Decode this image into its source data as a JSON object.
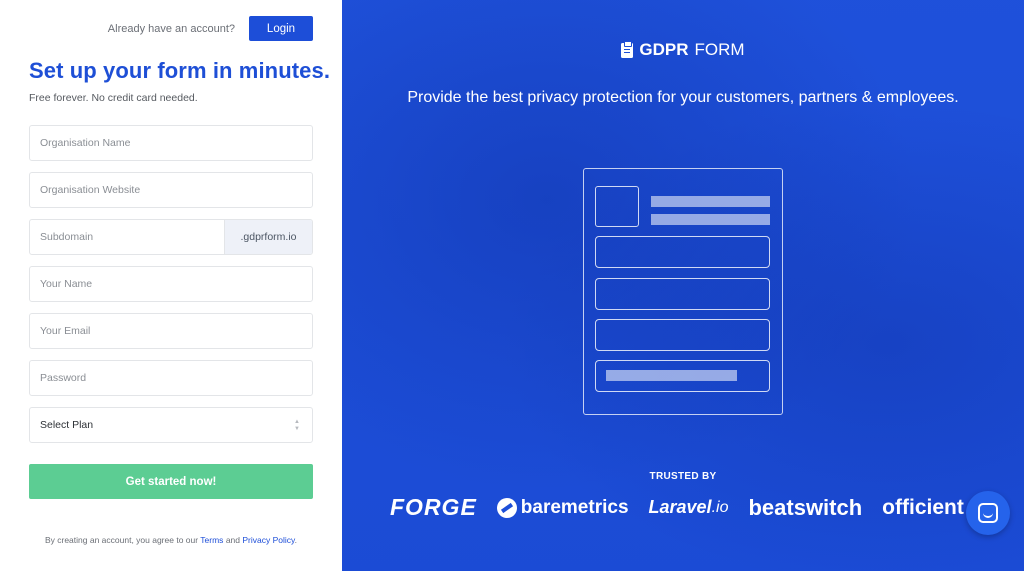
{
  "header": {
    "already_text": "Already have an account?",
    "login_label": "Login"
  },
  "signup": {
    "headline": "Set up your form in minutes.",
    "subline": "Free forever. No credit card needed.",
    "fields": {
      "org_name": "Organisation Name",
      "org_website": "Organisation Website",
      "subdomain": "Subdomain",
      "subdomain_suffix": ".gdprform.io",
      "your_name": "Your Name",
      "your_email": "Your Email",
      "password": "Password",
      "plan": "Select Plan"
    },
    "cta_label": "Get started now!",
    "terms_prefix": "By creating an account, you agree to our",
    "terms_link": "Terms",
    "terms_and": "and",
    "privacy_link": "Privacy Policy",
    "terms_suffix": "."
  },
  "promo": {
    "brand_bold": "GDPR",
    "brand_light": "FORM",
    "tagline": "Provide the best privacy protection for your customers, partners & employees.",
    "trusted_by": "TRUSTED BY",
    "logos": {
      "forge": "FORGE",
      "baremetrics": "baremetrics",
      "laravel": "Laravel",
      "laravel_suffix": ".io",
      "beatswitch": "beatswitch",
      "efficient": "officient"
    }
  },
  "colors": {
    "brand_blue": "#1d4fd8",
    "cta_green": "#5ccd93",
    "heading_blue": "#1e4fd6"
  },
  "icons": {
    "brand": "clipboard-icon",
    "chat": "chat-icon",
    "select": "chevron-updown-icon"
  }
}
